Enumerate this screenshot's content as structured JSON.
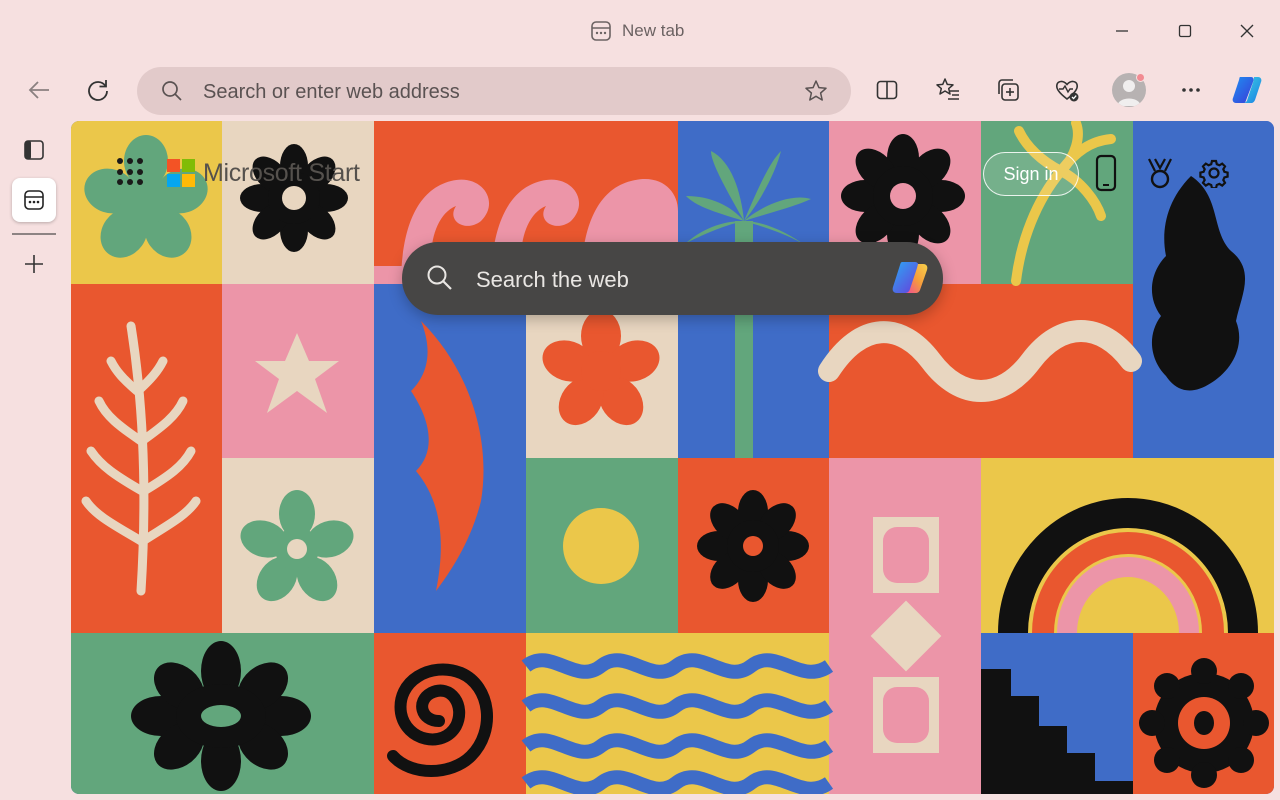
{
  "window": {
    "tab_title": "New tab",
    "controls": [
      "minimize",
      "maximize",
      "close"
    ]
  },
  "toolbar": {
    "address_placeholder": "Search or enter web address",
    "icons": [
      "back-icon",
      "refresh-icon",
      "favorite-star-icon",
      "split-screen-icon",
      "favorites-icon",
      "collections-icon",
      "browser-essentials-icon",
      "profile-avatar",
      "more-icon",
      "copilot-icon"
    ]
  },
  "rail": {
    "icons": [
      "tab-actions-icon",
      "current-tab-icon",
      "new-tab-plus-icon"
    ]
  },
  "start_page": {
    "brand": "Microsoft Start",
    "sign_in_label": "Sign in",
    "search_placeholder": "Search the web",
    "icons": [
      "apps-grid-icon",
      "phone-icon",
      "rewards-icon",
      "settings-gear-icon",
      "copilot-icon"
    ]
  },
  "colors": {
    "frame_bg": "#f6e0e0",
    "address_bg": "#e2caca",
    "search_bg": "#474645",
    "tile_orange": "#e9572f",
    "tile_blue": "#3f6cc7",
    "tile_green": "#62a67c",
    "tile_pink": "#ec95a8",
    "tile_yellow": "#ebc74a",
    "tile_beige": "#e8d6c0"
  }
}
